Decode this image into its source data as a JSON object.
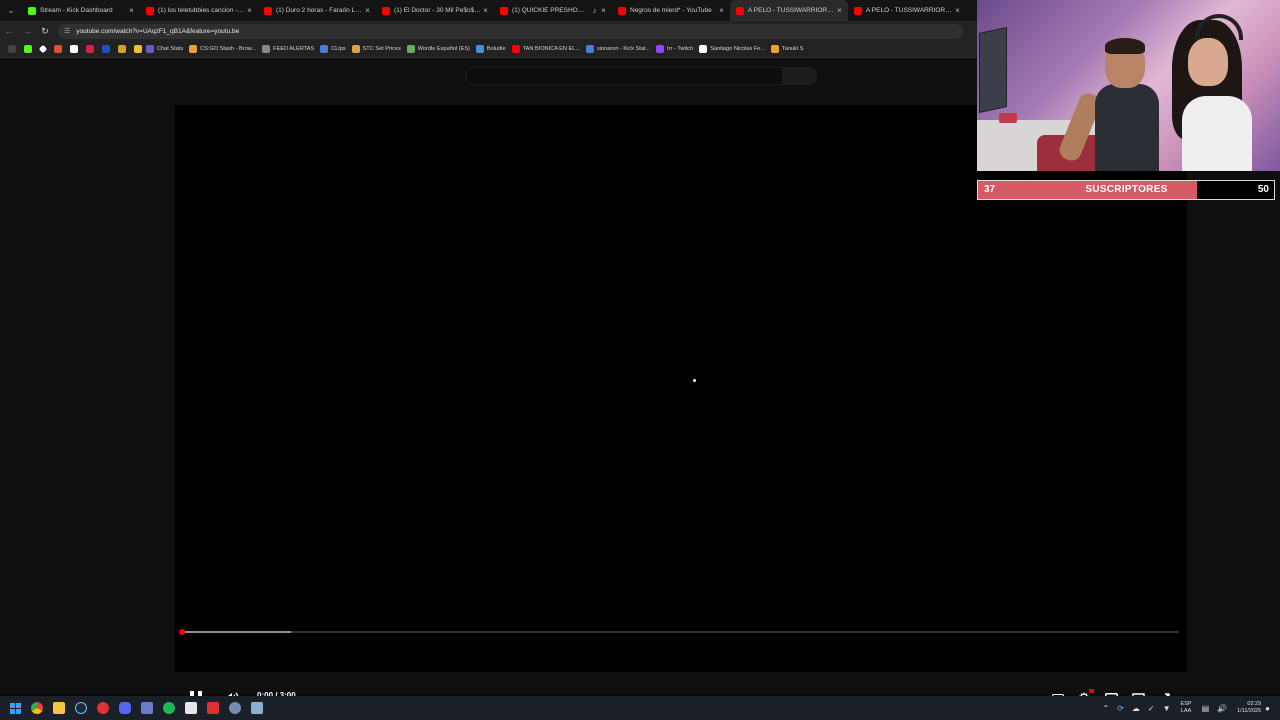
{
  "browser": {
    "tabs": [
      {
        "title": "Stream - Kick Dashboard",
        "favicon_color": "#53fc18",
        "active": false
      },
      {
        "title": "(1) los teletubbies cancion - Yo",
        "favicon_color": "#ff0000",
        "active": false
      },
      {
        "title": "(1) Duro 2 horas - Faraón Love",
        "favicon_color": "#ff0000",
        "active": false
      },
      {
        "title": "(1) El Doctor - 30 Mil Pe$o$ - Y",
        "favicon_color": "#ff0000",
        "active": false
      },
      {
        "title": "(1) QUICKIE PRESHOW (FLO",
        "favicon_color": "#ff0000",
        "active": false,
        "audio": true
      },
      {
        "title": "Negros de mierd* - YouTube",
        "favicon_color": "#ff0000",
        "active": false
      },
      {
        "title": "A PELO - TUSSIWARRIORS (VIC",
        "favicon_color": "#ff0000",
        "active": true
      },
      {
        "title": "A PELO - TUSSIWARRIORS (VIC",
        "favicon_color": "#ff0000",
        "active": false
      }
    ],
    "url": "youtube.com/watch?v=UAqzF1_qB1A&feature=youtu.be",
    "bookmarks": [
      {
        "label": "Chat Stats",
        "color": "#6a5acd"
      },
      {
        "label": "CS:GO Stash - Brow...",
        "color": "#f0a030"
      },
      {
        "label": "FEED ALERTAS",
        "color": "#888888"
      },
      {
        "label": "CLips",
        "color": "#4a7bd8"
      },
      {
        "label": "STC Set Prices",
        "color": "#e0a040"
      },
      {
        "label": "Wordle Español (ES)",
        "color": "#6aaa64"
      },
      {
        "label": "Boludle",
        "color": "#4a90d9"
      },
      {
        "label": "TAN BIONICA EN EL...",
        "color": "#ff0000"
      },
      {
        "label": "sionaron - Kick Stat...",
        "color": "#4a7bd8"
      },
      {
        "label": "trr - Twitch",
        "color": "#9146ff"
      },
      {
        "label": "Santiago Nicolas Fe...",
        "color": "#ffffff"
      },
      {
        "label": "Tanuki S",
        "color": "#f0a030"
      }
    ]
  },
  "player": {
    "time_display": "0:00 / 3:00",
    "played_fraction": 0.0,
    "buffered_fraction": 0.11
  },
  "overlay": {
    "sub_current": "37",
    "sub_label": "SUSCRIPTORES",
    "sub_goal": "50",
    "sub_fill_color": "#d65a64"
  },
  "taskbar": {
    "lang_top": "ESP",
    "lang_bottom": "LAA",
    "time": "02:29",
    "date": "1/11/2025"
  }
}
